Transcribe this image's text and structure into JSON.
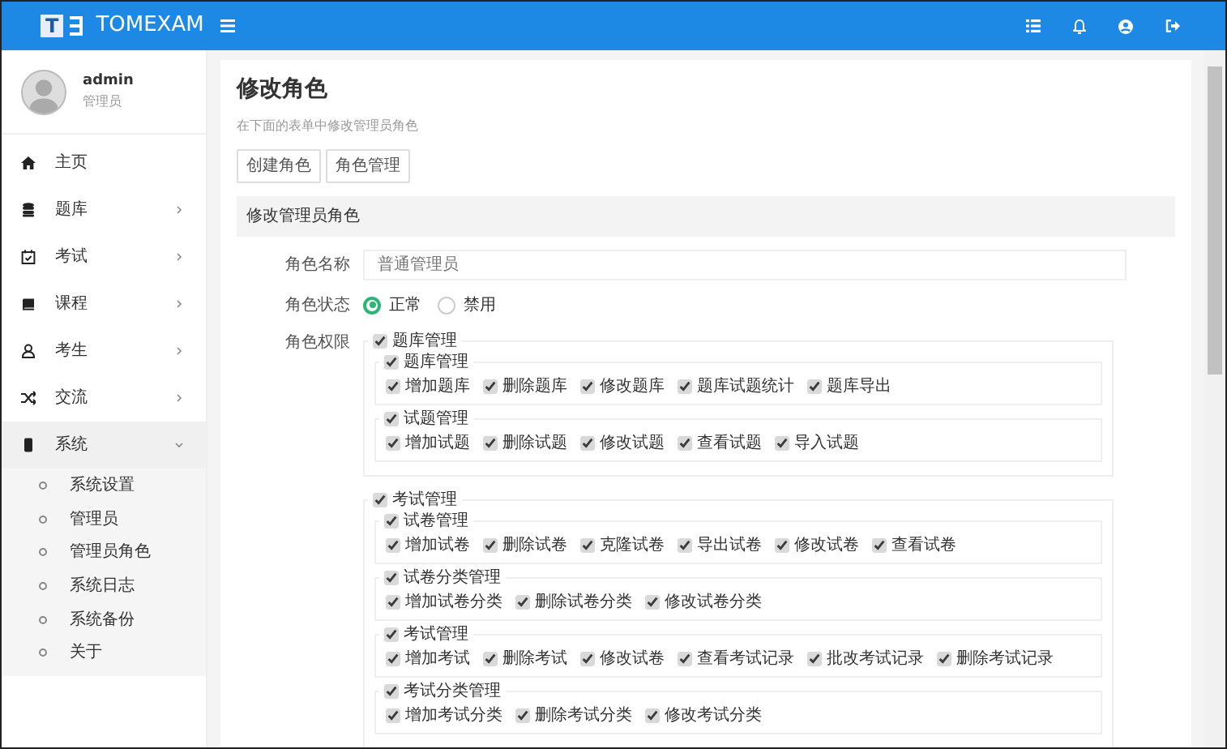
{
  "app": {
    "logo_mark": "T",
    "name": "TOMEXAM"
  },
  "user": {
    "name": "admin",
    "role": "管理员"
  },
  "sidebar": {
    "items": [
      {
        "label": "主页",
        "kind": "link"
      },
      {
        "label": "题库",
        "kind": "menu",
        "expanded": false
      },
      {
        "label": "考试",
        "kind": "menu",
        "expanded": false
      },
      {
        "label": "课程",
        "kind": "menu",
        "expanded": false
      },
      {
        "label": "考生",
        "kind": "menu",
        "expanded": false
      },
      {
        "label": "交流",
        "kind": "menu",
        "expanded": false
      },
      {
        "label": "系统",
        "kind": "menu",
        "expanded": true,
        "children": [
          {
            "label": "系统设置"
          },
          {
            "label": "管理员"
          },
          {
            "label": "管理员角色"
          },
          {
            "label": "系统日志"
          },
          {
            "label": "系统备份"
          },
          {
            "label": "关于"
          }
        ]
      }
    ]
  },
  "page": {
    "title": "修改角色",
    "subtitle": "在下面的表单中修改管理员角色",
    "buttons": [
      "创建角色",
      "角色管理"
    ],
    "section_title": "修改管理员角色"
  },
  "form": {
    "name": {
      "label": "角色名称",
      "value": "普通管理员"
    },
    "status": {
      "label": "角色状态",
      "options": [
        {
          "label": "正常",
          "selected": true
        },
        {
          "label": "禁用",
          "selected": false
        }
      ]
    },
    "permissions": {
      "label": "角色权限",
      "groups": [
        {
          "label": "题库管理",
          "checked": true,
          "children": [
            {
              "label": "题库管理",
              "checked": true,
              "children": [
                {
                  "label": "增加题库",
                  "checked": true
                },
                {
                  "label": "删除题库",
                  "checked": true
                },
                {
                  "label": "修改题库",
                  "checked": true
                },
                {
                  "label": "题库试题统计",
                  "checked": true
                },
                {
                  "label": "题库导出",
                  "checked": true
                }
              ]
            },
            {
              "label": "试题管理",
              "checked": true,
              "children": [
                {
                  "label": "增加试题",
                  "checked": true
                },
                {
                  "label": "删除试题",
                  "checked": true
                },
                {
                  "label": "修改试题",
                  "checked": true
                },
                {
                  "label": "查看试题",
                  "checked": true
                },
                {
                  "label": "导入试题",
                  "checked": true
                }
              ]
            }
          ]
        },
        {
          "label": "考试管理",
          "checked": true,
          "children": [
            {
              "label": "试卷管理",
              "checked": true,
              "children": [
                {
                  "label": "增加试卷",
                  "checked": true
                },
                {
                  "label": "删除试卷",
                  "checked": true
                },
                {
                  "label": "克隆试卷",
                  "checked": true
                },
                {
                  "label": "导出试卷",
                  "checked": true
                },
                {
                  "label": "修改试卷",
                  "checked": true
                },
                {
                  "label": "查看试卷",
                  "checked": true
                }
              ]
            },
            {
              "label": "试卷分类管理",
              "checked": true,
              "children": [
                {
                  "label": "增加试卷分类",
                  "checked": true
                },
                {
                  "label": "删除试卷分类",
                  "checked": true
                },
                {
                  "label": "修改试卷分类",
                  "checked": true
                }
              ]
            },
            {
              "label": "考试管理",
              "checked": true,
              "children": [
                {
                  "label": "增加考试",
                  "checked": true
                },
                {
                  "label": "删除考试",
                  "checked": true
                },
                {
                  "label": "修改试卷",
                  "checked": true
                },
                {
                  "label": "查看考试记录",
                  "checked": true
                },
                {
                  "label": "批改考试记录",
                  "checked": true
                },
                {
                  "label": "删除考试记录",
                  "checked": true
                }
              ]
            },
            {
              "label": "考试分类管理",
              "checked": true,
              "children": [
                {
                  "label": "增加考试分类",
                  "checked": true
                },
                {
                  "label": "删除考试分类",
                  "checked": true
                },
                {
                  "label": "修改考试分类",
                  "checked": true
                }
              ]
            }
          ]
        }
      ]
    }
  }
}
